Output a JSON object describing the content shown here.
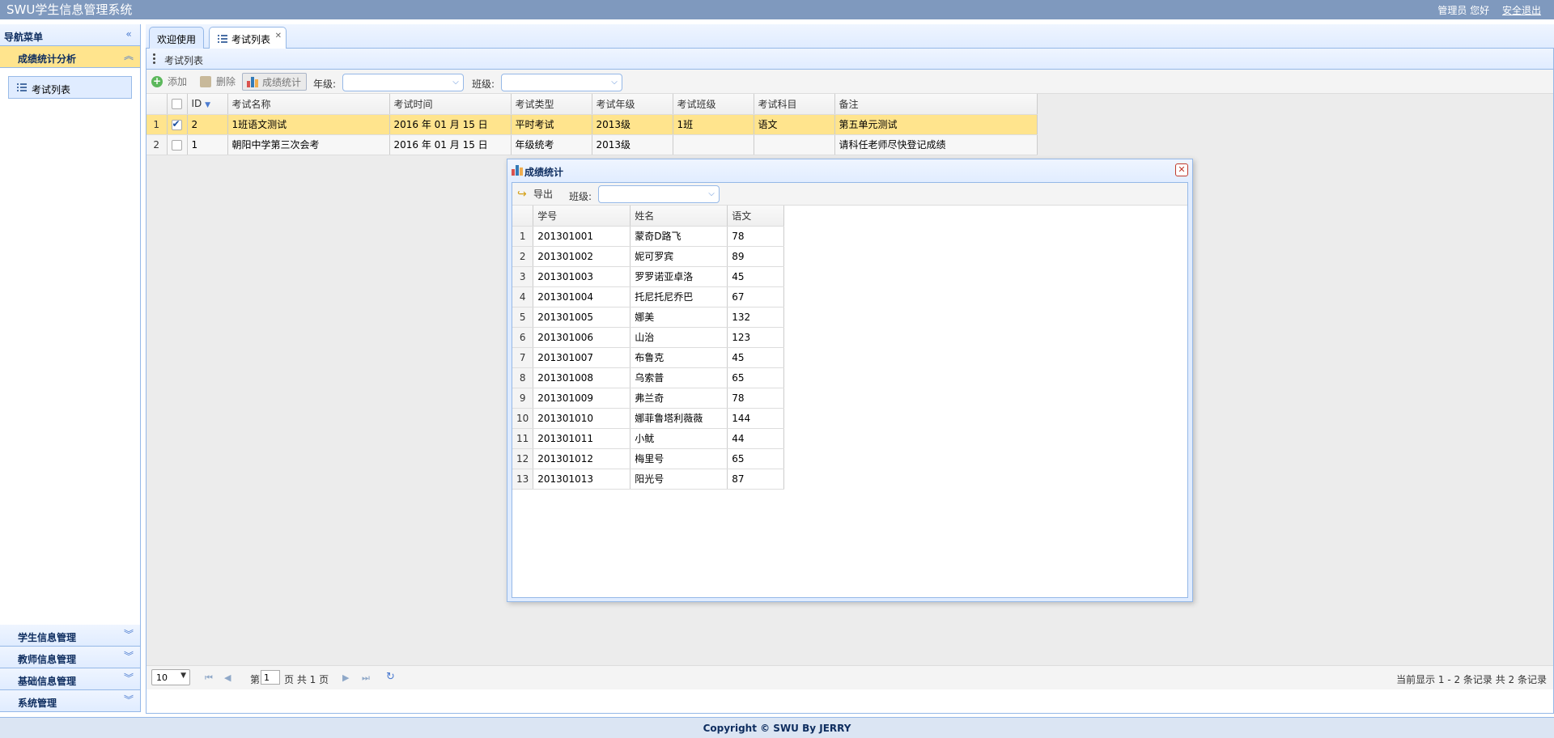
{
  "header": {
    "app_title": "SWU学生信息管理系统",
    "welcome": "管理员 您好",
    "logout": "安全退出"
  },
  "sidebar": {
    "title": "导航菜单",
    "active_section": "成绩统计分析",
    "active_item": "考试列表",
    "sections": [
      {
        "label": "学生信息管理"
      },
      {
        "label": "教师信息管理"
      },
      {
        "label": "基础信息管理"
      },
      {
        "label": "系统管理"
      }
    ]
  },
  "tabs": [
    {
      "label": "欢迎使用"
    },
    {
      "label": "考试列表",
      "active": true
    }
  ],
  "panel": {
    "title": "考试列表"
  },
  "toolbar": {
    "add": "添加",
    "delete": "删除",
    "stats": "成绩统计",
    "grade_label": "年级:",
    "grade_value": "",
    "class_label": "班级:",
    "class_value": ""
  },
  "exam_grid": {
    "columns": [
      "ID",
      "考试名称",
      "考试时间",
      "考试类型",
      "考试年级",
      "考试班级",
      "考试科目",
      "备注"
    ],
    "rows": [
      {
        "rn": "1",
        "checked": true,
        "id": "2",
        "name": "1班语文测试",
        "time": "2016 年 01 月 15 日",
        "type": "平时考试",
        "grade": "2013级",
        "clazz": "1班",
        "subject": "语文",
        "remark": "第五单元测试"
      },
      {
        "rn": "2",
        "checked": false,
        "id": "1",
        "name": "朝阳中学第三次会考",
        "time": "2016 年 01 月 15 日",
        "type": "年级统考",
        "grade": "2013级",
        "clazz": "",
        "subject": "",
        "remark": "请科任老师尽快登记成绩"
      }
    ]
  },
  "dialog": {
    "title": "成绩统计",
    "export": "导出",
    "class_label": "班级:",
    "class_value": "",
    "columns": [
      "学号",
      "姓名",
      "语文"
    ],
    "rows": [
      {
        "rn": "1",
        "no": "201301001",
        "name": "蒙奇D路飞",
        "score": "78"
      },
      {
        "rn": "2",
        "no": "201301002",
        "name": "妮可罗宾",
        "score": "89"
      },
      {
        "rn": "3",
        "no": "201301003",
        "name": "罗罗诺亚卓洛",
        "score": "45"
      },
      {
        "rn": "4",
        "no": "201301004",
        "name": "托尼托尼乔巴",
        "score": "67"
      },
      {
        "rn": "5",
        "no": "201301005",
        "name": "娜美",
        "score": "132"
      },
      {
        "rn": "6",
        "no": "201301006",
        "name": "山治",
        "score": "123"
      },
      {
        "rn": "7",
        "no": "201301007",
        "name": "布鲁克",
        "score": "45"
      },
      {
        "rn": "8",
        "no": "201301008",
        "name": "乌索普",
        "score": "65"
      },
      {
        "rn": "9",
        "no": "201301009",
        "name": "弗兰奇",
        "score": "78"
      },
      {
        "rn": "10",
        "no": "201301010",
        "name": "娜菲鲁塔利薇薇",
        "score": "144"
      },
      {
        "rn": "11",
        "no": "201301011",
        "name": "小鱿",
        "score": "44"
      },
      {
        "rn": "12",
        "no": "201301012",
        "name": "梅里号",
        "score": "65"
      },
      {
        "rn": "13",
        "no": "201301013",
        "name": "阳光号",
        "score": "87"
      }
    ]
  },
  "pager": {
    "page_size": "10",
    "page_prefix": "第",
    "page_value": "1",
    "page_suffix": "页 共 1 页",
    "summary": "当前显示 1 - 2 条记录 共 2 条记录"
  },
  "footer": {
    "copyright": "Copyright © SWU By JERRY"
  },
  "colors": {
    "header_bg": "#7f99be",
    "border": "#95b8e7",
    "selected_row": "#ffe48d"
  }
}
